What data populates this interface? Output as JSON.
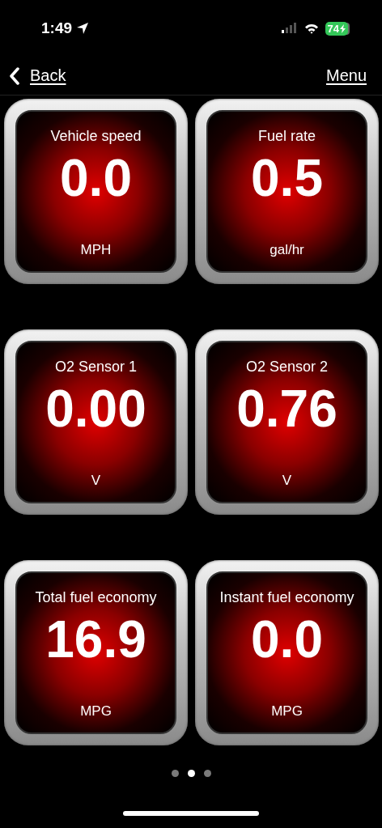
{
  "status_bar": {
    "time": "1:49",
    "battery": "74"
  },
  "nav": {
    "back": "Back",
    "menu": "Menu"
  },
  "gauges": [
    {
      "title": "Vehicle speed",
      "value": "0.0",
      "unit": "MPH"
    },
    {
      "title": "Fuel rate",
      "value": "0.5",
      "unit": "gal/hr"
    },
    {
      "title": "O2 Sensor 1",
      "value": "0.00",
      "unit": "V"
    },
    {
      "title": "O2 Sensor 2",
      "value": "0.76",
      "unit": "V"
    },
    {
      "title": "Total fuel economy",
      "value": "16.9",
      "unit": "MPG"
    },
    {
      "title": "Instant fuel economy",
      "value": "0.0",
      "unit": "MPG"
    }
  ],
  "pages": [
    {
      "selected": false
    },
    {
      "selected": true
    },
    {
      "selected": false
    }
  ]
}
